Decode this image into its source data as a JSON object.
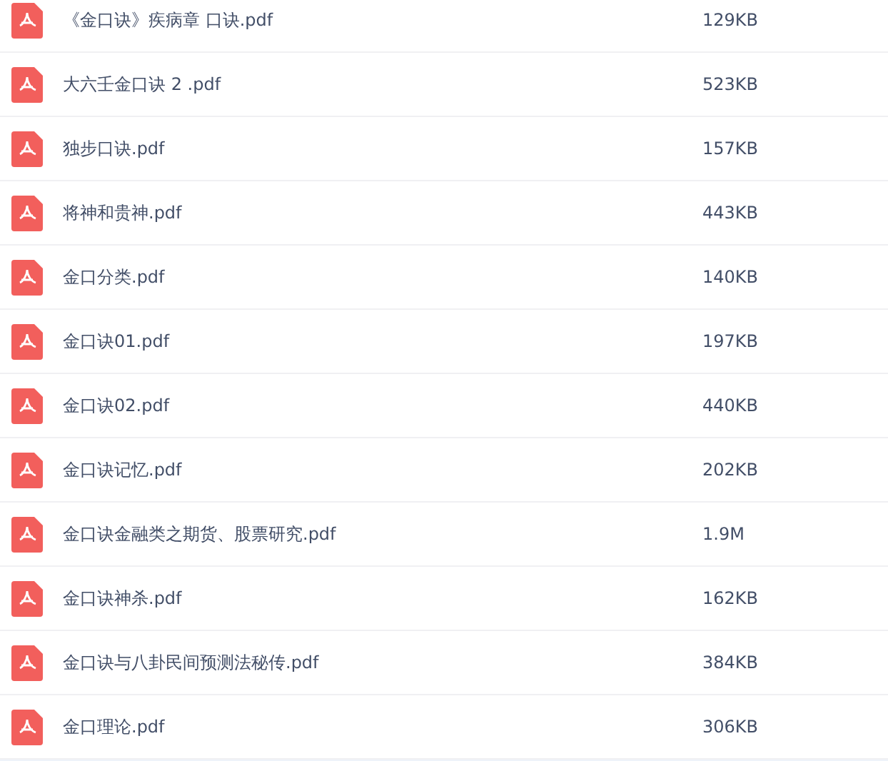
{
  "files": [
    {
      "name": "《金口诀》疾病章 口诀.pdf",
      "size": "129KB"
    },
    {
      "name": "大六壬金口诀 2 .pdf",
      "size": "523KB"
    },
    {
      "name": "独步口诀.pdf",
      "size": "157KB"
    },
    {
      "name": "将神和贵神.pdf",
      "size": "443KB"
    },
    {
      "name": "金口分类.pdf",
      "size": "140KB"
    },
    {
      "name": "金口诀01.pdf",
      "size": "197KB"
    },
    {
      "name": "金口诀02.pdf",
      "size": "440KB"
    },
    {
      "name": "金口诀记忆.pdf",
      "size": "202KB"
    },
    {
      "name": "金口诀金融类之期货、股票研究.pdf",
      "size": "1.9M"
    },
    {
      "name": "金口诀神杀.pdf",
      "size": "162KB"
    },
    {
      "name": "金口诀与八卦民间预测法秘传.pdf",
      "size": "384KB"
    },
    {
      "name": "金口理论.pdf",
      "size": "306KB"
    }
  ]
}
